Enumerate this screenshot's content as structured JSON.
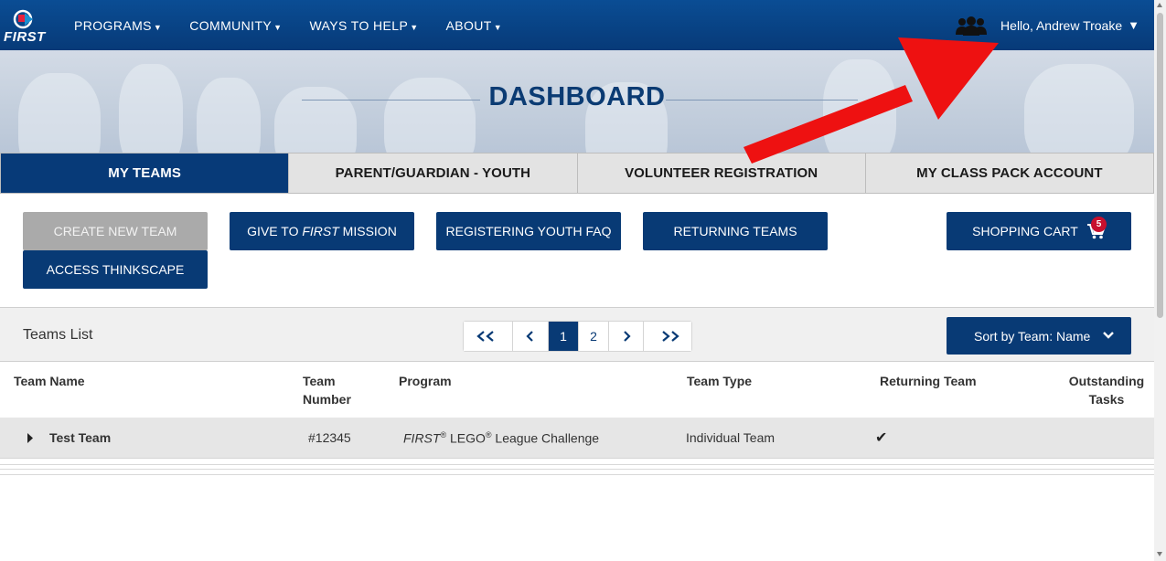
{
  "nav": {
    "logo_text": "FIRST",
    "menu": [
      {
        "label": "PROGRAMS"
      },
      {
        "label": "COMMUNITY"
      },
      {
        "label": "WAYS TO HELP"
      },
      {
        "label": "ABOUT"
      }
    ],
    "greeting": "Hello, Andrew Troake",
    "user_icon": "users-icon"
  },
  "hero": {
    "title": "DASHBOARD"
  },
  "tabs": [
    {
      "label": "MY TEAMS",
      "active": true
    },
    {
      "label": "PARENT/GUARDIAN - YOUTH",
      "active": false
    },
    {
      "label": "VOLUNTEER REGISTRATION",
      "active": false
    },
    {
      "label": "MY CLASS PACK ACCOUNT",
      "active": false
    }
  ],
  "actions": {
    "create_new_team": "CREATE NEW TEAM",
    "give_prefix": "GIVE TO ",
    "give_first": "FIRST",
    "give_suffix": " MISSION",
    "registering_youth_faq": "REGISTERING YOUTH FAQ",
    "returning_teams": "RETURNING TEAMS",
    "shopping_cart": "SHOPPING CART",
    "cart_count": "5",
    "access_thinkscape": "ACCESS THINKSCAPE"
  },
  "teams_list": {
    "title": "Teams List",
    "pagination": {
      "first": "first-page-icon",
      "prev": "prev-page-icon",
      "pages": [
        "1",
        "2"
      ],
      "current": "1",
      "next": "next-page-icon",
      "last": "last-page-icon"
    },
    "sort_label": "Sort by Team: Name",
    "columns": {
      "team_name": "Team Name",
      "team_number_line1": "Team",
      "team_number_line2": "Number",
      "program": "Program",
      "team_type": "Team Type",
      "returning_team": "Returning Team",
      "outstanding_line1": "Outstanding",
      "outstanding_line2": "Tasks"
    },
    "rows": [
      {
        "name": "Test Team",
        "number": "#12345",
        "program_first": "FIRST",
        "program_lego": " LEGO",
        "program_rest": " League Challenge",
        "registered": "®",
        "team_type": "Individual Team",
        "returning": "✔",
        "outstanding": ""
      }
    ]
  },
  "colors": {
    "brand_blue": "#083a75",
    "tab_active": "#073a78",
    "badge_red": "#c8102e",
    "disabled_gray": "#aaaaaa"
  }
}
